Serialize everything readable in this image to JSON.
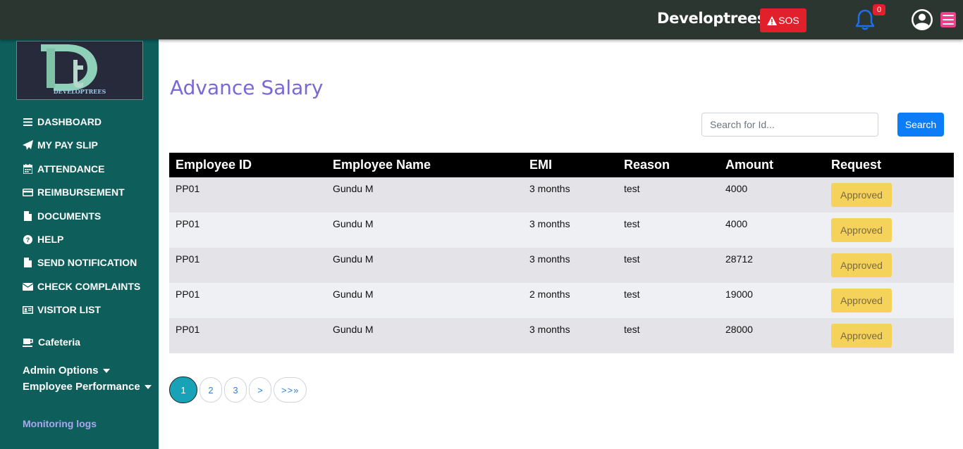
{
  "header": {
    "brand": "Developtrees",
    "sos_label": "SOS",
    "notification_count": "0"
  },
  "colors": {
    "topbar": "#2b3630",
    "sidebar": "#0e5e5c",
    "title": "#7b68d4",
    "sos": "#e0202a",
    "search_button": "#0d7df7",
    "approved": "#f5d25a",
    "pager_active": "#17a2b8"
  },
  "sidebar": {
    "logo_text": "DEVELOPTREES",
    "items": [
      {
        "label": "DASHBOARD",
        "icon": "bars-icon"
      },
      {
        "label": "MY PAY SLIP",
        "icon": "paper-plane-icon"
      },
      {
        "label": "ATTENDANCE",
        "icon": "calendar-icon"
      },
      {
        "label": "REIMBURSEMENT",
        "icon": "credit-card-icon"
      },
      {
        "label": "DOCUMENTS",
        "icon": "file-icon"
      },
      {
        "label": "HELP",
        "icon": "question-circle-icon"
      },
      {
        "label": "SEND NOTIFICATION",
        "icon": "file-icon"
      },
      {
        "label": "CHECK COMPLAINTS",
        "icon": "envelope-icon"
      },
      {
        "label": "VISITOR LIST",
        "icon": "id-card-icon"
      }
    ],
    "cafeteria": "Cafeteria",
    "admin_options": "Admin Options",
    "employee_performance": "Employee Performance",
    "monitoring_logs": "Monitoring logs"
  },
  "main": {
    "title": "Advance Salary",
    "search": {
      "placeholder": "Search for Id...",
      "button": "Search"
    },
    "table": {
      "headers": [
        "Employee ID",
        "Employee Name",
        "EMI",
        "Reason",
        "Amount",
        "Request"
      ],
      "rows": [
        [
          "PP01",
          "Gundu M",
          "3 months",
          "test",
          "4000",
          "Approved"
        ],
        [
          "PP01",
          "Gundu M",
          "3 months",
          "test",
          "4000",
          "Approved"
        ],
        [
          "PP01",
          "Gundu M",
          "3 months",
          "test",
          "28712",
          "Approved"
        ],
        [
          "PP01",
          "Gundu M",
          "2 months",
          "test",
          "19000",
          "Approved"
        ],
        [
          "PP01",
          "Gundu M",
          "3 months",
          "test",
          "28000",
          "Approved"
        ]
      ]
    },
    "pagination": [
      "1",
      "2",
      "3",
      ">",
      ">>»"
    ]
  }
}
